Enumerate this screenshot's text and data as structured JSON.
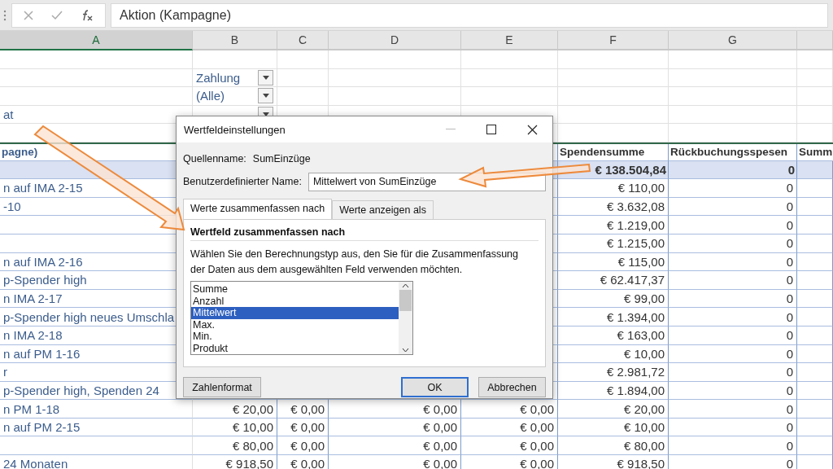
{
  "formula_bar": {
    "value": "Aktion (Kampagne)"
  },
  "columns": [
    {
      "label": "A",
      "selected": true
    },
    {
      "label": "B",
      "selected": false
    },
    {
      "label": "C",
      "selected": false
    },
    {
      "label": "D",
      "selected": false
    },
    {
      "label": "E",
      "selected": false
    },
    {
      "label": "F",
      "selected": false
    },
    {
      "label": "G",
      "selected": false
    }
  ],
  "rows": [
    {
      "kind": "blank"
    },
    {
      "kind": "filter",
      "b": "Zahlung"
    },
    {
      "kind": "filter",
      "b": "(Alle)"
    },
    {
      "kind": "filter",
      "a": "at"
    },
    {
      "kind": "blank"
    },
    {
      "kind": "header",
      "a": "pagne)",
      "f": "Spendensumme",
      "g": "Rückbuchungsspesen",
      "h": "Summ"
    },
    {
      "kind": "total",
      "f": "€ 138.504,84",
      "g": "0"
    },
    {
      "kind": "data",
      "a": "n auf IMA 2-15",
      "f": "€ 110,00",
      "g": "0"
    },
    {
      "kind": "data",
      "a": "-10",
      "f": "€ 3.632,08",
      "g": "0"
    },
    {
      "kind": "data",
      "f": "€ 1.219,00",
      "g": "0"
    },
    {
      "kind": "data",
      "f": "€ 1.215,00",
      "g": "0"
    },
    {
      "kind": "data",
      "a": "n auf IMA 2-16",
      "f": "€ 115,00",
      "g": "0"
    },
    {
      "kind": "data",
      "a": "p-Spender high",
      "f": "€ 62.417,37",
      "g": "0"
    },
    {
      "kind": "data",
      "a": "n IMA 2-17",
      "f": "€ 99,00",
      "g": "0"
    },
    {
      "kind": "data",
      "a": "p-Spender high neues Umschla",
      "f": "€ 1.394,00",
      "g": "0"
    },
    {
      "kind": "data",
      "a": "n IMA 2-18",
      "f": "€ 163,00",
      "g": "0"
    },
    {
      "kind": "data",
      "a": "n auf PM 1-16",
      "f": "€ 10,00",
      "g": "0"
    },
    {
      "kind": "data",
      "a": "r",
      "f": "€ 2.981,72",
      "g": "0"
    },
    {
      "kind": "data",
      "a": "p-Spender high, Spenden 24",
      "f": "€ 1.894,00",
      "g": "0"
    },
    {
      "kind": "data",
      "a": "n PM 1-18",
      "b": "€ 20,00",
      "c": "€ 0,00",
      "d": "€ 0,00",
      "e": "€ 0,00",
      "f": "€ 20,00",
      "g": "0"
    },
    {
      "kind": "data",
      "a": "n auf PM 2-15",
      "b": "€ 10,00",
      "c": "€ 0,00",
      "d": "€ 0,00",
      "e": "€ 0,00",
      "f": "€ 10,00",
      "g": "0"
    },
    {
      "kind": "data",
      "b": "€ 80,00",
      "c": "€ 0,00",
      "d": "€ 0,00",
      "e": "€ 0,00",
      "f": "€ 80,00",
      "g": "0"
    },
    {
      "kind": "data",
      "a": "24 Monaten",
      "b": "€ 918,50",
      "c": "€ 0,00",
      "d": "€ 0,00",
      "e": "€ 0,00",
      "f": "€ 918,50",
      "g": "0"
    }
  ],
  "dialog": {
    "title": "Wertfeldeinstellungen",
    "source_label": "Quellenname:",
    "source_value": "SumEinzüge",
    "name_label": "Benutzerdefinierter Name:",
    "name_value": "Mittelwert von SumEinzüge",
    "tabs": [
      {
        "label": "Werte zusammenfassen nach",
        "selected": true
      },
      {
        "label": "Werte anzeigen als",
        "selected": false
      }
    ],
    "section_title": "Wertfeld zusammenfassen nach",
    "description": "Wählen Sie den Berechnungstyp aus, den Sie für die Zusammenfassung der Daten aus dem ausgewählten Feld verwenden möchten.",
    "options": [
      {
        "label": "Summe",
        "selected": false
      },
      {
        "label": "Anzahl",
        "selected": false
      },
      {
        "label": "Mittelwert",
        "selected": true
      },
      {
        "label": "Max.",
        "selected": false
      },
      {
        "label": "Min.",
        "selected": false
      },
      {
        "label": "Produkt",
        "selected": false
      }
    ],
    "buttons": [
      {
        "label": "Zahlenformat",
        "kind": "left"
      },
      {
        "label": "OK",
        "kind": "default"
      },
      {
        "label": "Abbrechen",
        "kind": "normal"
      }
    ]
  }
}
